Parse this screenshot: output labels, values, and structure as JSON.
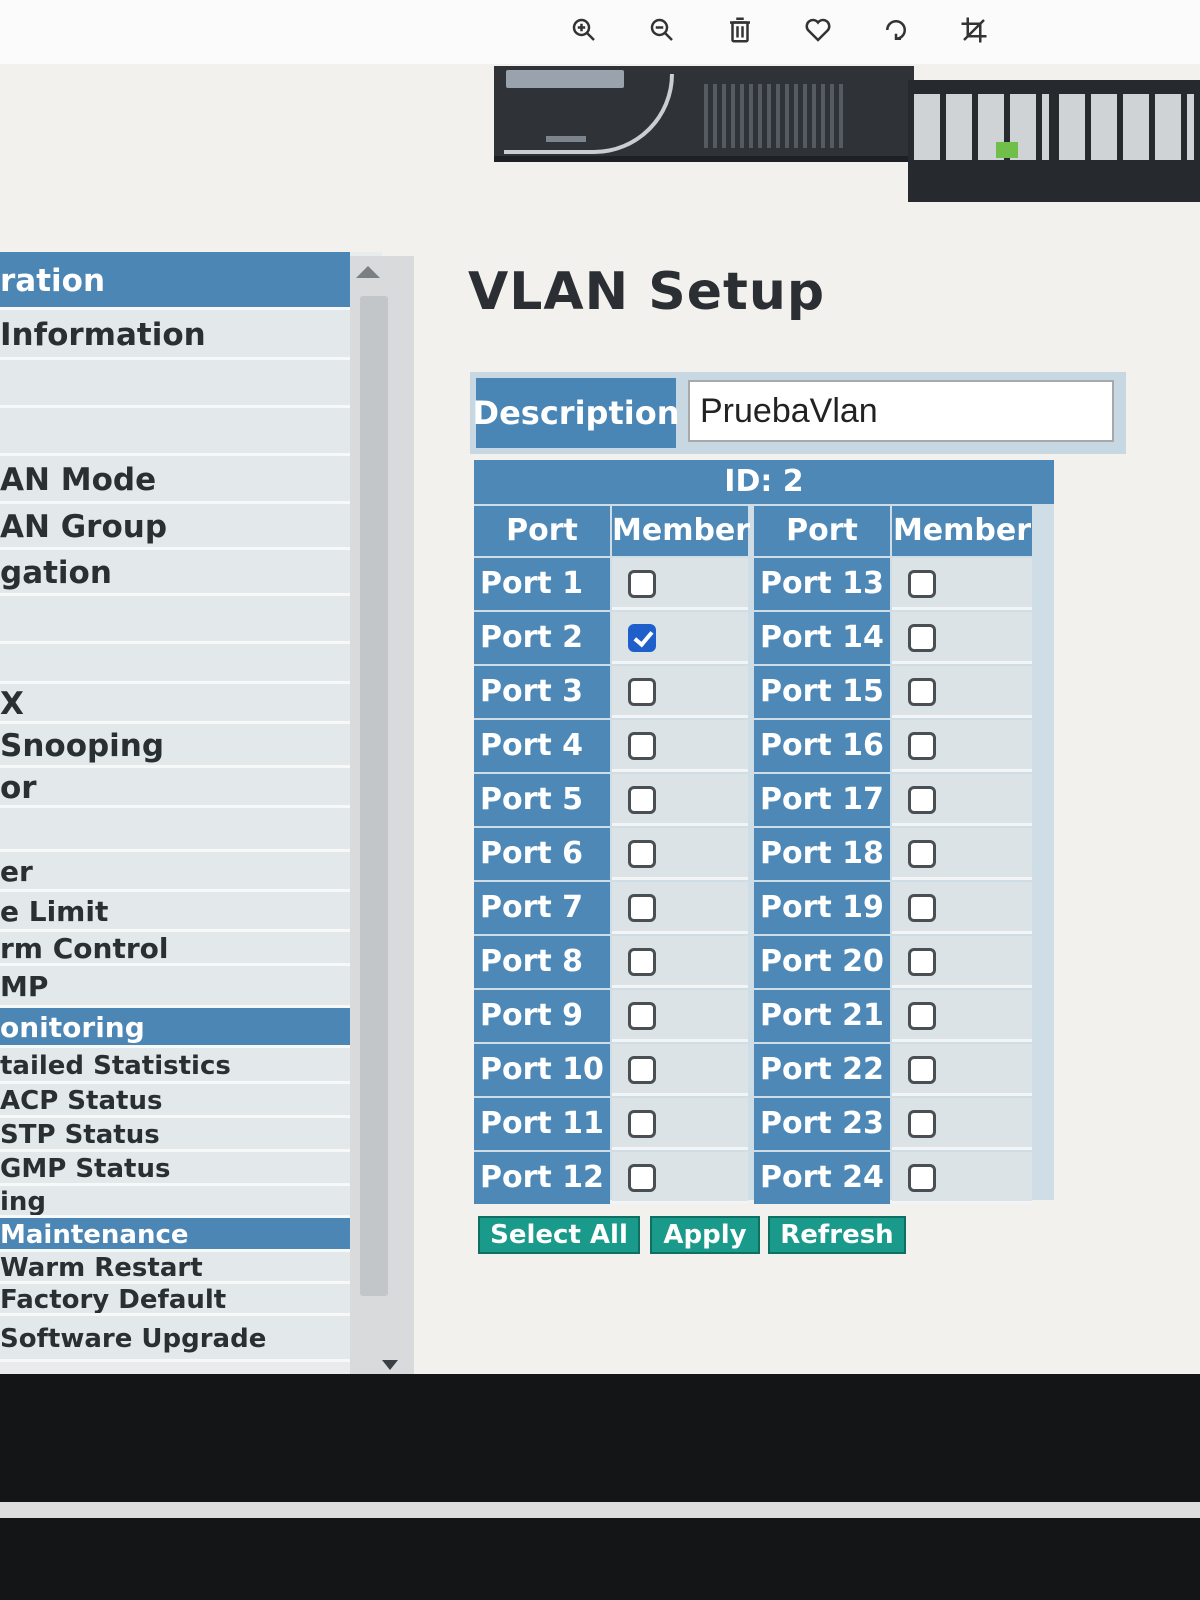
{
  "viewer": {
    "tools": [
      "zoom-in-icon",
      "zoom-out-icon",
      "trash-icon",
      "heart-icon",
      "rotate-icon",
      "crop-icon"
    ]
  },
  "nav": {
    "items": [
      {
        "label": "ration",
        "header": true
      },
      {
        "label": "Information",
        "header": false
      },
      {
        "label": "",
        "header": false
      },
      {
        "label": "",
        "header": false
      },
      {
        "label": "AN Mode",
        "header": false
      },
      {
        "label": "AN Group",
        "header": false
      },
      {
        "label": "gation",
        "header": false
      },
      {
        "label": "",
        "header": false
      },
      {
        "label": "",
        "header": false
      },
      {
        "label": "X",
        "header": false
      },
      {
        "label": "Snooping",
        "header": false
      },
      {
        "label": "or",
        "header": false
      },
      {
        "label": "",
        "header": false
      },
      {
        "label": "er",
        "header": false
      },
      {
        "label": "e Limit",
        "header": false
      },
      {
        "label": "rm Control",
        "header": false
      },
      {
        "label": "MP",
        "header": false
      },
      {
        "label": "onitoring",
        "header": true
      },
      {
        "label": "tailed Statistics",
        "header": false
      },
      {
        "label": "ACP Status",
        "header": false
      },
      {
        "label": "STP Status",
        "header": false
      },
      {
        "label": "GMP Status",
        "header": false
      },
      {
        "label": "ing",
        "header": false
      },
      {
        "label": "Maintenance",
        "header": true
      },
      {
        "label": "Warm Restart",
        "header": false
      },
      {
        "label": "Factory Default",
        "header": false
      },
      {
        "label": "Software Upgrade",
        "header": false
      }
    ]
  },
  "page": {
    "title": "VLAN Setup",
    "description_label": "Description",
    "description_value": "PruebaVlan",
    "id_label": "ID: 2",
    "col_port": "Port",
    "col_member": "Member"
  },
  "ports": [
    {
      "name": "Port 1",
      "member": false
    },
    {
      "name": "Port 2",
      "member": true
    },
    {
      "name": "Port 3",
      "member": false
    },
    {
      "name": "Port 4",
      "member": false
    },
    {
      "name": "Port 5",
      "member": false
    },
    {
      "name": "Port 6",
      "member": false
    },
    {
      "name": "Port 7",
      "member": false
    },
    {
      "name": "Port 8",
      "member": false
    },
    {
      "name": "Port 9",
      "member": false
    },
    {
      "name": "Port 10",
      "member": false
    },
    {
      "name": "Port 11",
      "member": false
    },
    {
      "name": "Port 12",
      "member": false
    },
    {
      "name": "Port 13",
      "member": false
    },
    {
      "name": "Port 14",
      "member": false
    },
    {
      "name": "Port 15",
      "member": false
    },
    {
      "name": "Port 16",
      "member": false
    },
    {
      "name": "Port 17",
      "member": false
    },
    {
      "name": "Port 18",
      "member": false
    },
    {
      "name": "Port 19",
      "member": false
    },
    {
      "name": "Port 20",
      "member": false
    },
    {
      "name": "Port 21",
      "member": false
    },
    {
      "name": "Port 22",
      "member": false
    },
    {
      "name": "Port 23",
      "member": false
    },
    {
      "name": "Port 24",
      "member": false
    }
  ],
  "buttons": {
    "select_all": "Select All",
    "apply": "Apply",
    "refresh": "Refresh"
  },
  "colors": {
    "header_blue": "#4d88b7",
    "button_teal": "#1a9a8a",
    "check_blue": "#1f5fcc"
  }
}
